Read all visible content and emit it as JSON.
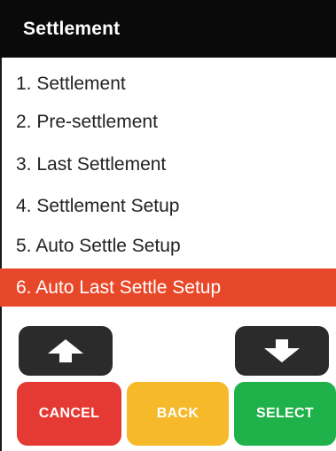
{
  "header": {
    "title": "Settlement"
  },
  "menu": {
    "items": [
      {
        "label": "1. Settlement"
      },
      {
        "label": "2. Pre-settlement"
      },
      {
        "label": "3. Last Settlement"
      },
      {
        "label": "4. Settlement Setup"
      },
      {
        "label": "5. Auto Settle Setup"
      },
      {
        "label": "6. Auto Last Settle Setup"
      }
    ],
    "selected_index": 6
  },
  "controls": {
    "up_icon": "up-arrow-icon",
    "down_icon": "down-arrow-icon",
    "cancel_label": "CANCEL",
    "back_label": "BACK",
    "select_label": "SELECT"
  },
  "colors": {
    "header_bg": "#0a0a0a",
    "selected_bg": "#e8482a",
    "nav_button": "#2b2b2b",
    "cancel": "#e53a34",
    "back": "#f5b92a",
    "select": "#1fb24a"
  }
}
